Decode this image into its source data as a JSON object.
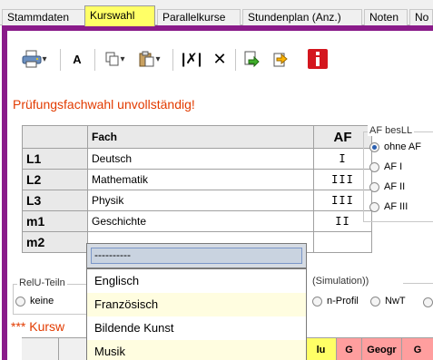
{
  "tabs": [
    {
      "label": "Stammdaten",
      "active": false
    },
    {
      "label": "Kurswahl",
      "active": true
    },
    {
      "label": "Parallelkurse",
      "active": false
    },
    {
      "label": "Stundenplan (Anz.)",
      "active": false
    },
    {
      "label": "Noten",
      "active": false
    },
    {
      "label": "No",
      "active": false
    }
  ],
  "toolbar": {
    "icons": [
      "printer-icon",
      "font-icon",
      "copy-icon",
      "paste-icon",
      "clear-marked-icon",
      "delete-icon",
      "import-icon",
      "export-icon",
      "info-icon"
    ],
    "font_label": "A"
  },
  "warning": "Prüfungsfachwahl unvollständig!",
  "table": {
    "headers": [
      "",
      "Fach",
      "AF"
    ],
    "rows": [
      {
        "key": "L1",
        "fach": "Deutsch",
        "af": "I"
      },
      {
        "key": "L2",
        "fach": "Mathematik",
        "af": "III"
      },
      {
        "key": "L3",
        "fach": "Physik",
        "af": "III"
      },
      {
        "key": "m1",
        "fach": "Geschichte",
        "af": "II"
      },
      {
        "key": "m2",
        "fach": "",
        "af": ""
      }
    ]
  },
  "af_group": {
    "legend": "AF besLL",
    "options": [
      {
        "label": "ohne AF",
        "selected": true
      },
      {
        "label": "AF I",
        "selected": false
      },
      {
        "label": "AF II",
        "selected": false
      },
      {
        "label": "AF III",
        "selected": false
      }
    ]
  },
  "relu": {
    "legend": "RelU-Teiln",
    "option": "keine"
  },
  "simulation": {
    "legend": "(Simulation))",
    "options": [
      {
        "label": "n-Profil",
        "selected": false
      },
      {
        "label": "NwT",
        "selected": false
      }
    ]
  },
  "kurswahl_heading": "*** Kursw",
  "bottom_columns": [
    {
      "label": "lu",
      "bg": "#ffff66"
    },
    {
      "label": "G",
      "bg": "#ff9e9e"
    },
    {
      "label": "Geogr",
      "bg": "#ff9e9e"
    },
    {
      "label": "G",
      "bg": "#ff9e9e"
    }
  ],
  "dropdown": {
    "current_value": "----------",
    "items": [
      {
        "label": "Englisch",
        "highlight": false
      },
      {
        "label": "Französisch",
        "highlight": true
      },
      {
        "label": "Bildende Kunst",
        "highlight": false
      },
      {
        "label": "Musik",
        "highlight": true
      }
    ]
  },
  "colors": {
    "frame": "#8a1b8a",
    "active_tab": "#ffff66",
    "warning": "#e23b00",
    "info_button": "#d4161e"
  }
}
